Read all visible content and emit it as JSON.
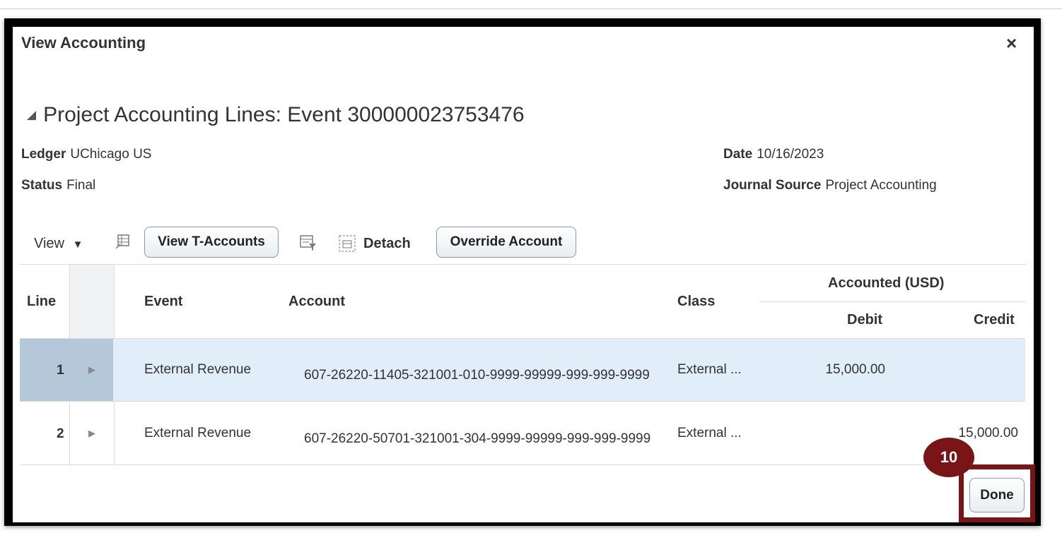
{
  "dialog": {
    "title": "View Accounting",
    "close_glyph": "×"
  },
  "section": {
    "title": "Project Accounting Lines: Event 300000023753476",
    "collapse_glyph": "◢"
  },
  "fields": {
    "ledger_label": "Ledger",
    "ledger_value": "UChicago US",
    "status_label": "Status",
    "status_value": "Final",
    "date_label": "Date",
    "date_value": "10/16/2023",
    "journal_source_label": "Journal Source",
    "journal_source_value": "Project Accounting"
  },
  "toolbar": {
    "view_label": "View",
    "view_t_accounts_label": "View T-Accounts",
    "detach_label": "Detach",
    "override_account_label": "Override Account"
  },
  "table": {
    "headers": {
      "line": "Line",
      "event": "Event",
      "account": "Account",
      "class": "Class",
      "accounted": "Accounted (USD)",
      "debit": "Debit",
      "credit": "Credit"
    },
    "rows": [
      {
        "line": "1",
        "event": "External Revenue",
        "account": "607-26220-11405-321001-010-9999-99999-999-999-9999",
        "class": "External ...",
        "debit": "15,000.00",
        "credit": ""
      },
      {
        "line": "2",
        "event": "External Revenue",
        "account": "607-26220-50701-321001-304-9999-99999-999-999-9999",
        "class": "External ...",
        "debit": "",
        "credit": "15,000.00"
      }
    ]
  },
  "callout": {
    "step_number": "10"
  },
  "done_label": "Done",
  "colors": {
    "callout": "#7a1416",
    "selected_row": "#e1eefa",
    "selected_row_number": "#b4c8da"
  }
}
